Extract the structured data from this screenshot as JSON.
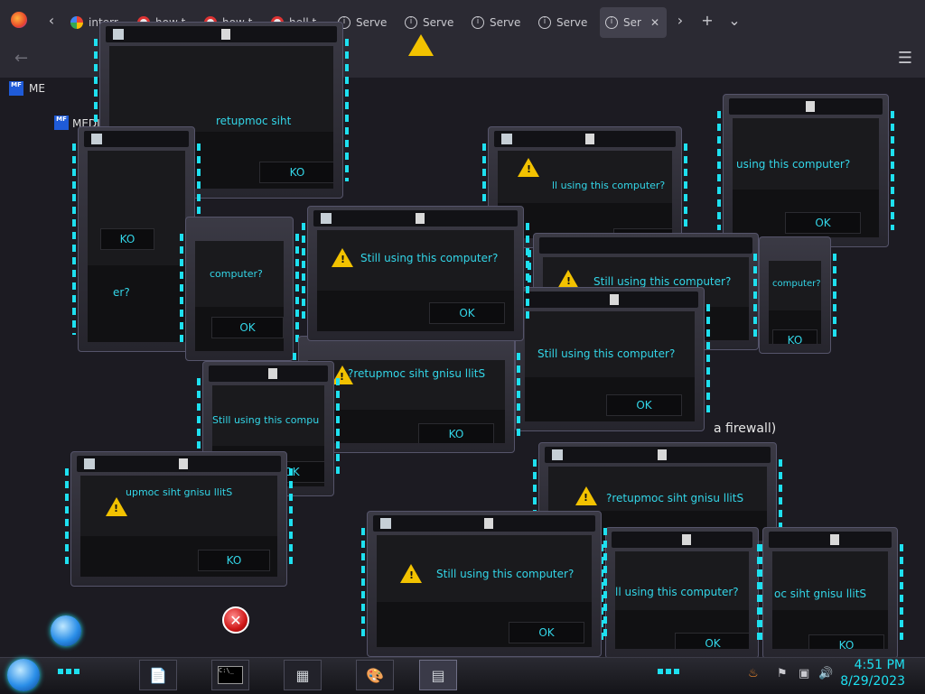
{
  "browser": {
    "tabs": [
      {
        "label": "interr",
        "icon": "google-icon"
      },
      {
        "label": "how t",
        "icon": "red-site-icon"
      },
      {
        "label": "how t",
        "icon": "red-site-icon"
      },
      {
        "label": "hell t",
        "icon": "red-site-icon"
      },
      {
        "label": "Serve",
        "icon": "info-icon"
      },
      {
        "label": "Serve",
        "icon": "info-icon"
      },
      {
        "label": "Serve",
        "icon": "info-icon"
      },
      {
        "label": "Serve",
        "icon": "info-icon"
      },
      {
        "label": "Ser",
        "icon": "info-icon",
        "active": true
      }
    ],
    "close_glyph": "✕",
    "new_tab_glyph": "+",
    "list_tabs_glyph": "⌄",
    "page_header": "MEDIAFIRE F",
    "page_header_short": "ME",
    "logo_text": "MF"
  },
  "page": {
    "fragment_text": "a firewall)"
  },
  "dialog": {
    "message": "Still using this computer?",
    "message_mirrored": "?retupmoc siht gnisu llitS",
    "message_partial_1": "Still using this compu",
    "message_partial_2": "ll using this computer?",
    "message_partial_3": "upmoc siht gnisu llitS",
    "message_partial_4": "oc siht gnisu llitS",
    "message_partial_5": "computer?",
    "message_partial_6": "using this computer?",
    "message_partial_7": "retupmoc siht",
    "message_partial_8": "er?",
    "ok_label": "OK",
    "ok_mirrored": "KO",
    "accent_color": "#33d6e8"
  },
  "taskbar": {
    "clock_time": "4:51 PM",
    "clock_date": "8/29/2023",
    "apps": [
      "wordpad-icon",
      "cmd-icon",
      "calculator-icon",
      "paint-icon",
      "notepad-icon"
    ],
    "cmd_text": "C:\\_"
  },
  "colors": {
    "accent_cyan": "#1ee0f0",
    "warning_yellow": "#f2c200",
    "chrome_bg": "#2b2a33"
  }
}
